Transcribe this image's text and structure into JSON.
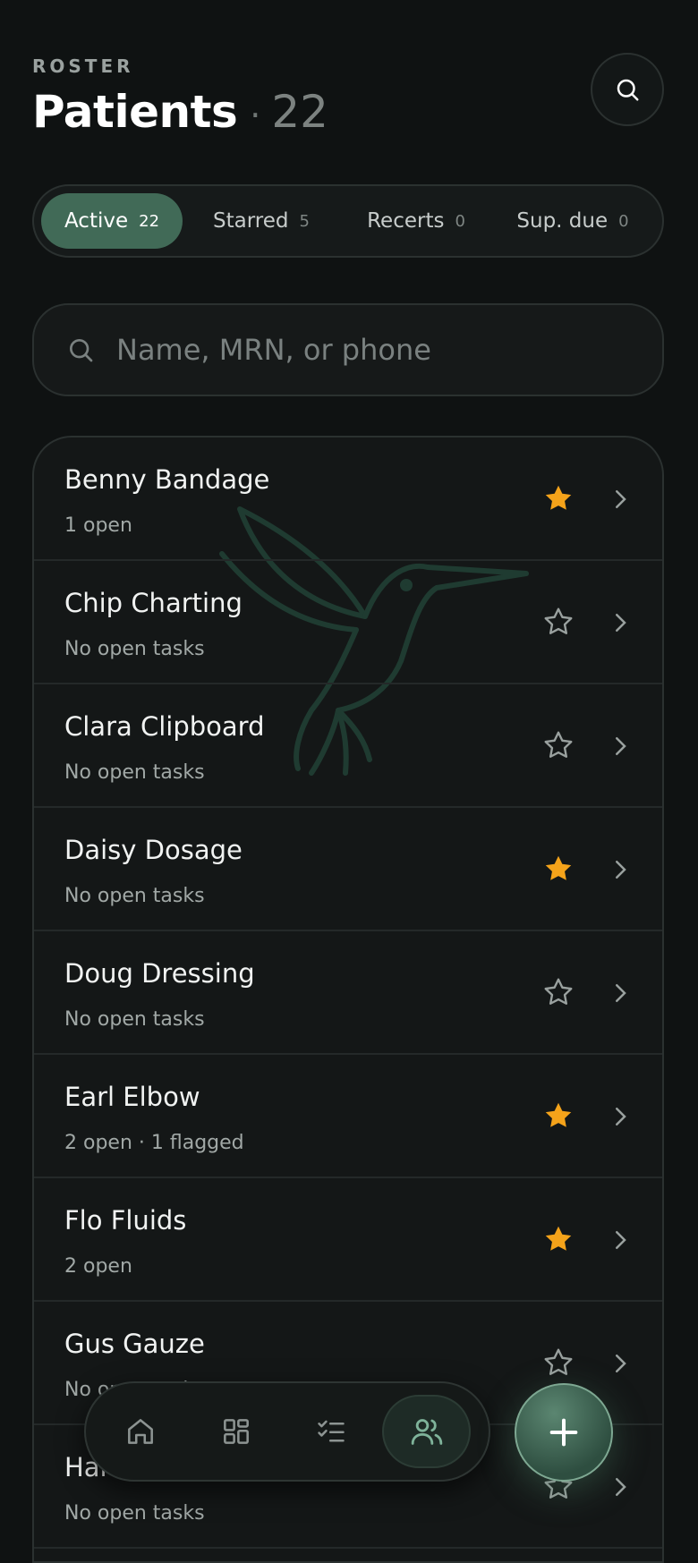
{
  "header": {
    "eyebrow": "ROSTER",
    "title": "Patients",
    "separator": "·",
    "count": "22"
  },
  "segments": [
    {
      "label": "Active",
      "count": "22",
      "active": true
    },
    {
      "label": "Starred",
      "count": "5",
      "active": false
    },
    {
      "label": "Recerts",
      "count": "0",
      "active": false
    },
    {
      "label": "Sup. due",
      "count": "0",
      "active": false
    }
  ],
  "search": {
    "placeholder": "Name, MRN, or phone",
    "icon": "search-icon"
  },
  "patients": [
    {
      "name": "Benny Bandage",
      "status": "1 open",
      "starred": true
    },
    {
      "name": "Chip Charting",
      "status": "No open tasks",
      "starred": false
    },
    {
      "name": "Clara Clipboard",
      "status": "No open tasks",
      "starred": false
    },
    {
      "name": "Daisy Dosage",
      "status": "No open tasks",
      "starred": true
    },
    {
      "name": "Doug Dressing",
      "status": "No open tasks",
      "starred": false
    },
    {
      "name": "Earl Elbow",
      "status": "2 open · 1 flagged",
      "starred": true
    },
    {
      "name": "Flo Fluids",
      "status": "2 open",
      "starred": true
    },
    {
      "name": "Gus Gauze",
      "status": "No open tasks",
      "starred": false
    },
    {
      "name": "Harriet Hydration",
      "status": "No open tasks",
      "starred": false
    }
  ],
  "tabbar": {
    "tabs": [
      {
        "icon": "home-icon",
        "active": false
      },
      {
        "icon": "grid-icon",
        "active": false
      },
      {
        "icon": "checklist-icon",
        "active": false
      },
      {
        "icon": "people-icon",
        "active": true
      }
    ]
  },
  "fab": {
    "icon": "plus-icon"
  },
  "colors": {
    "background": "#0f1212",
    "accent": "#416a57",
    "star": "#f5a31a",
    "muted": "#a1a8a6"
  }
}
